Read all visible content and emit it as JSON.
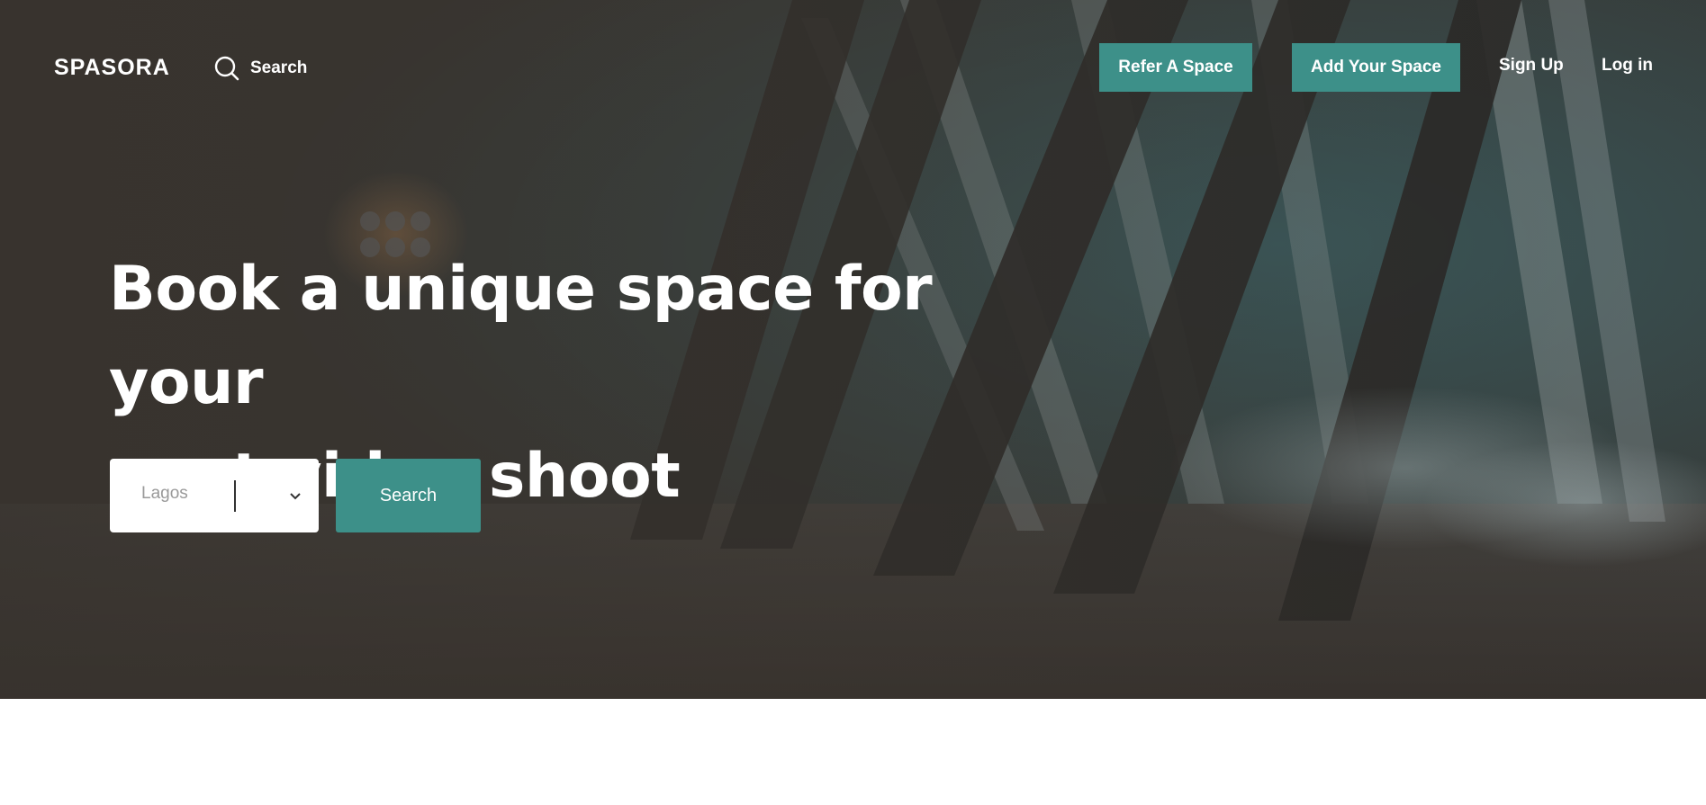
{
  "brand": {
    "logo_text": "SPASORA"
  },
  "nav": {
    "search_label": "Search",
    "search_icon": "search-icon",
    "refer_label": "Refer A Space",
    "add_label": "Add Your Space",
    "signup_label": "Sign Up",
    "login_label": "Log in"
  },
  "hero": {
    "headline_line1": "Book a unique space for your",
    "headline_line2": "next video shoot",
    "location_value": "Lagos",
    "dropdown_icon": "chevron-down-icon",
    "search_button_label": "Search"
  },
  "colors": {
    "accent": "#3d9089",
    "text_on_dark": "#ffffff",
    "select_placeholder": "#9a9a9a"
  }
}
